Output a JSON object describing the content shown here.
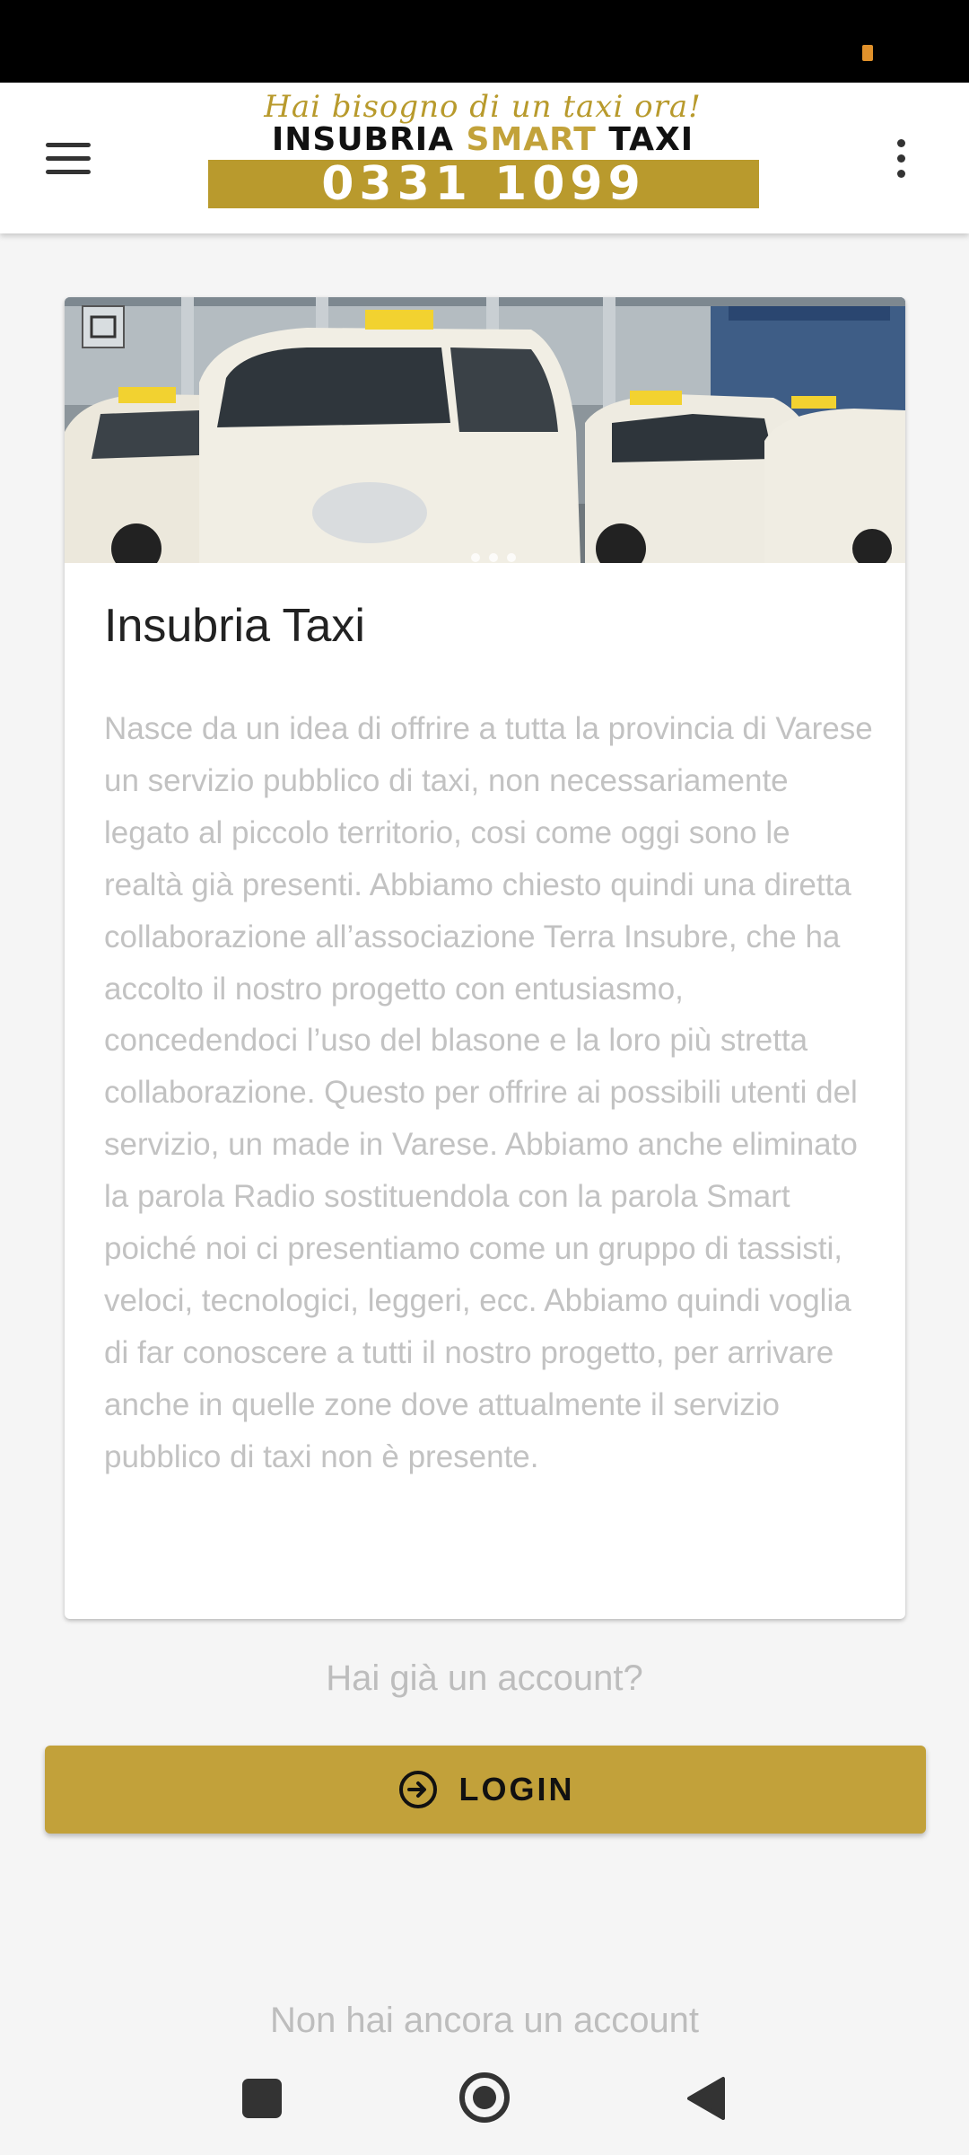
{
  "app_bar": {
    "menu_icon": "hamburger-menu-icon",
    "more_icon": "more-vertical-icon",
    "logo": {
      "tagline": "Hai bisogno di un taxi ora!",
      "brand_part1": "INSUBRIA ",
      "brand_part2": "SMART",
      "brand_part3": " TAXI",
      "phone": "0331 1099"
    }
  },
  "card": {
    "image_alt": "Taxi rank with white taxis",
    "title": "Insubria Taxi",
    "body": "Nasce da un idea di offrire a tutta la provincia di Varese un servizio pubblico di taxi, non necessariamente legato al piccolo territorio, cosi come oggi sono le realtà già presenti. Abbiamo chiesto quindi una diretta collaborazione all’associazione Terra Insubre, che ha accolto il nostro progetto con entusiasmo, concedendoci l’uso del blasone e la loro più stretta collaborazione. Questo per offrire ai possibili utenti del servizio, un made in Varese. Abbiamo anche eliminato la parola Radio sostituendola con la parola Smart poiché noi ci presentiamo come un gruppo di tassisti, veloci, tecnologici, leggeri, ecc. Abbiamo quindi voglia di far conoscere a tutti il nostro progetto, per arrivare anche in quelle zone dove attualmente il servizio pubblico di taxi non è presente."
  },
  "auth": {
    "have_account": "Hai già un account?",
    "login_label": "LOGIN",
    "login_icon": "login-arrow-icon",
    "no_account": "Non hai ancora un account"
  },
  "nav": {
    "recents_icon": "recents-square-icon",
    "home_icon": "home-circle-icon",
    "back_icon": "back-triangle-icon"
  },
  "colors": {
    "accent": "#c2a13a",
    "status_dot": "#e0912b"
  }
}
